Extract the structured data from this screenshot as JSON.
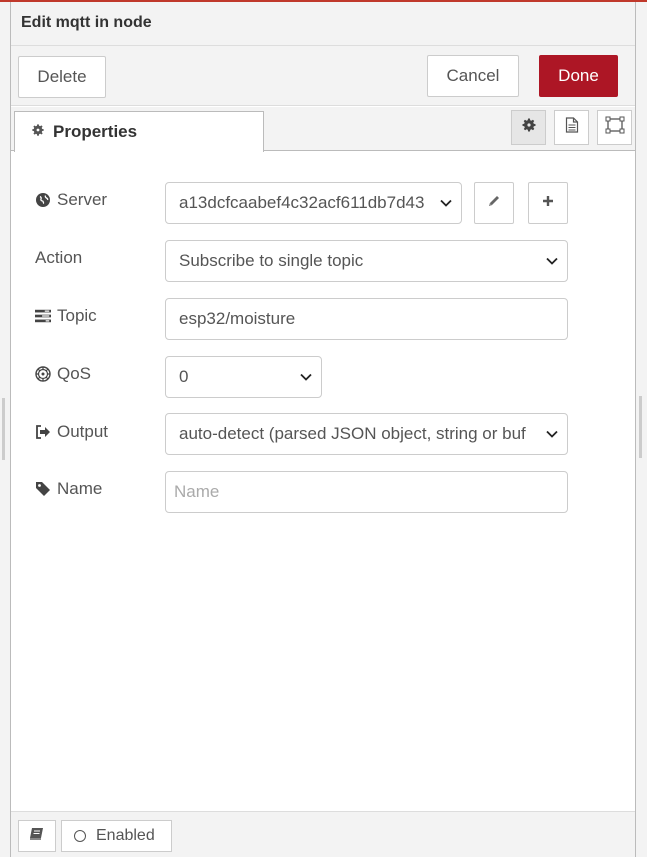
{
  "tray": {
    "title": "Edit mqtt in node"
  },
  "toolbar": {
    "delete_label": "Delete",
    "cancel_label": "Cancel",
    "done_label": "Done",
    "done_color": "#ad1625"
  },
  "tabs": {
    "properties_label": "Properties",
    "icons": [
      "gear-icon",
      "file-text-icon",
      "window-maximize-icon"
    ]
  },
  "form": {
    "server": {
      "label": "Server",
      "value": "a13dcfcaabef4c32acf611db7d43",
      "icon": "globe-icon"
    },
    "action": {
      "label": "Action",
      "value": "Subscribe to single topic"
    },
    "topic": {
      "label": "Topic",
      "value": "esp32/moisture",
      "icon": "tasks-icon"
    },
    "qos": {
      "label": "QoS",
      "value": "0",
      "icon": "empire-icon"
    },
    "output": {
      "label": "Output",
      "value": "auto-detect (parsed JSON object, string or buf",
      "icon": "sign-out-icon"
    },
    "name": {
      "label": "Name",
      "value": "",
      "placeholder": "Name",
      "icon": "tag-icon"
    }
  },
  "footer": {
    "enabled_label": "Enabled"
  }
}
